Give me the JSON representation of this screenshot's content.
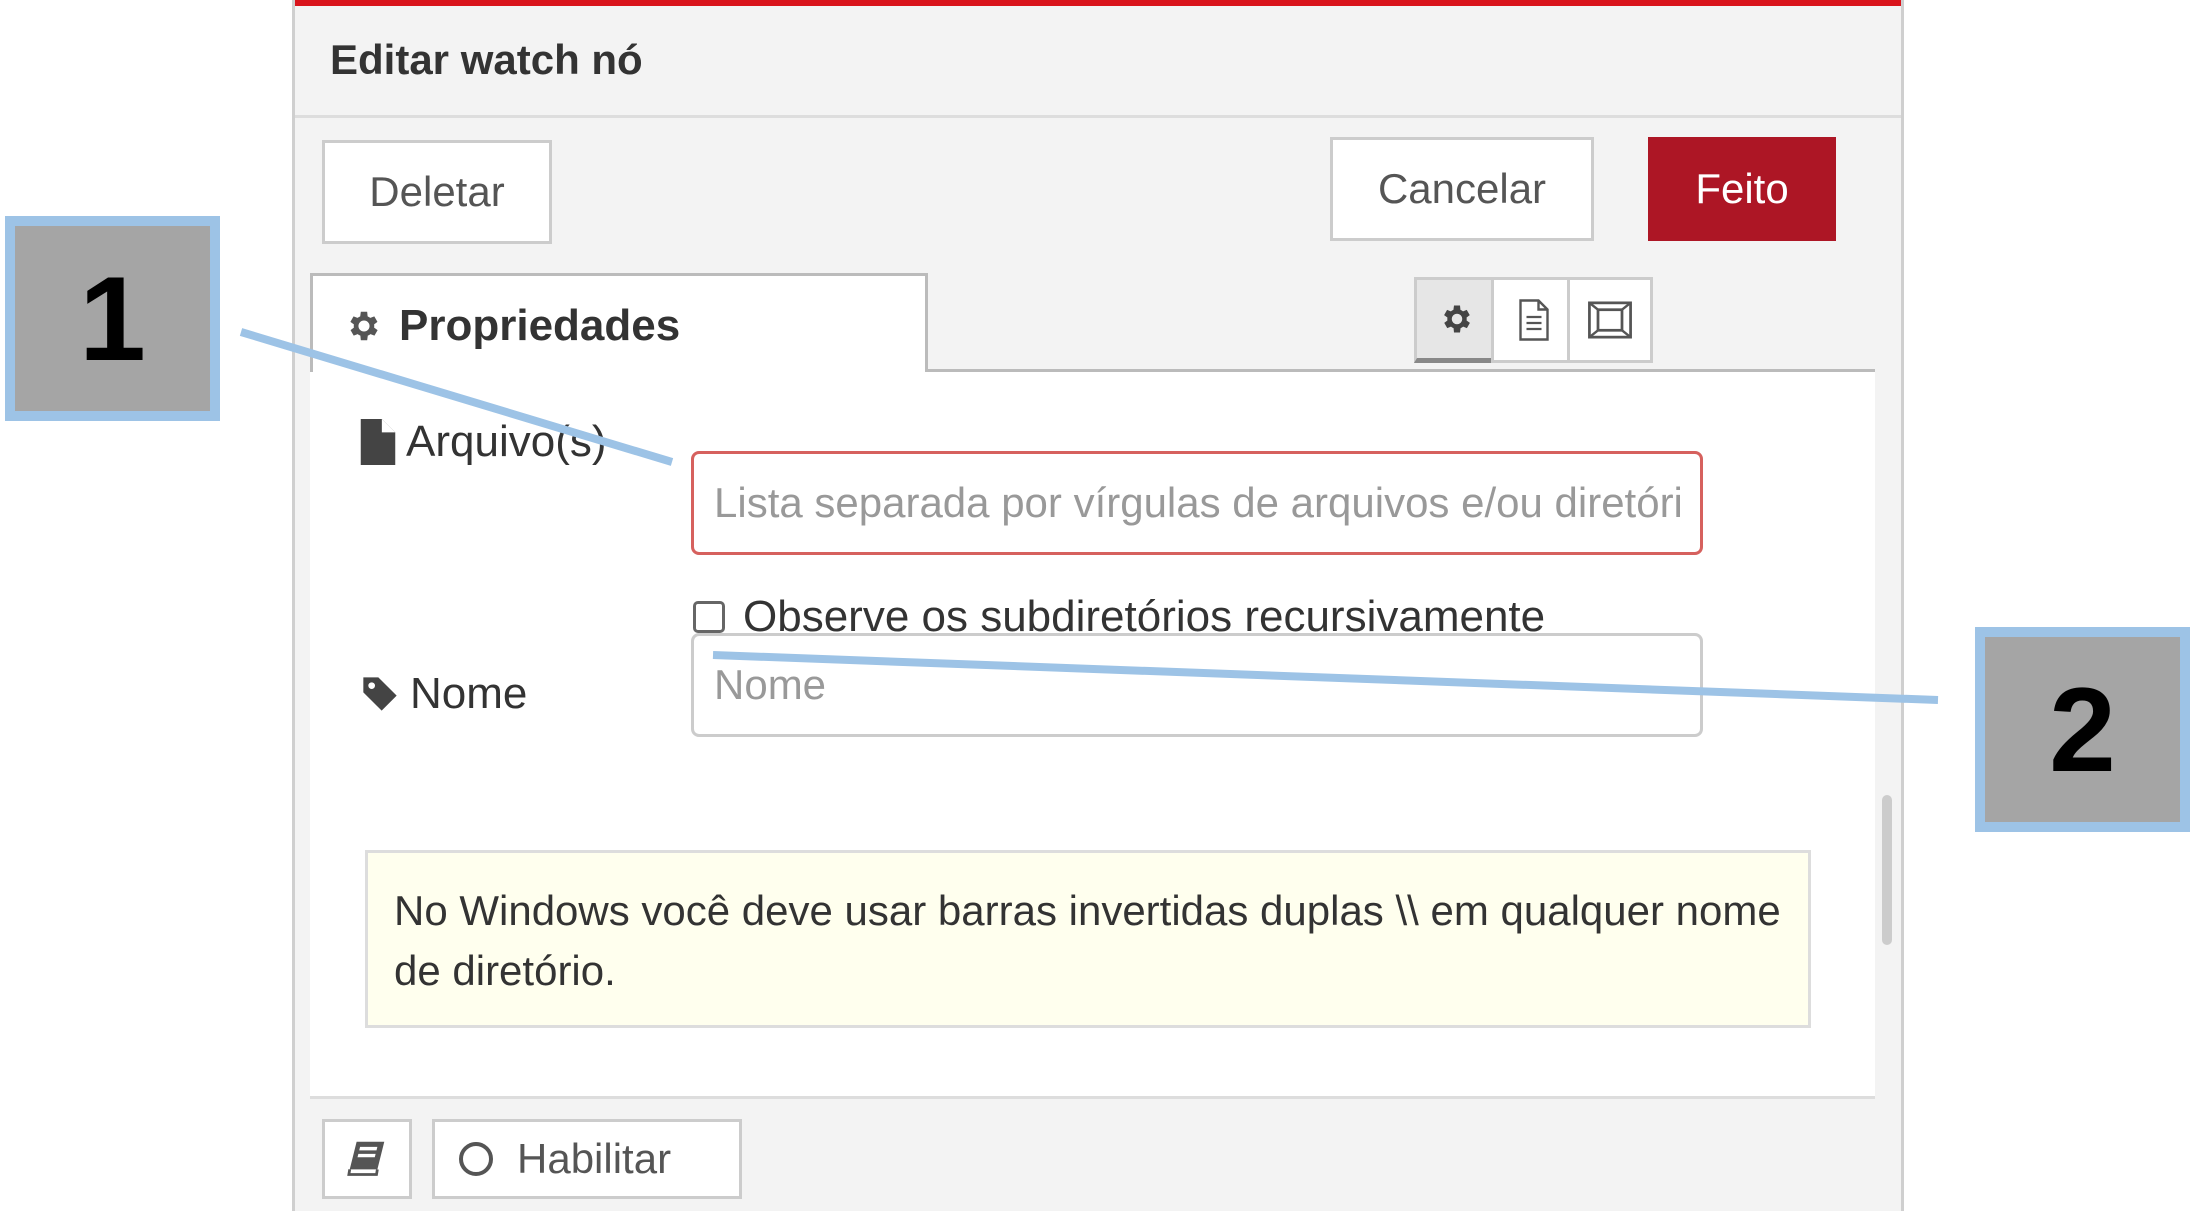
{
  "dialog": {
    "title": "Editar watch nó",
    "buttons": {
      "delete": "Deletar",
      "cancel": "Cancelar",
      "done": "Feito"
    },
    "tabs": {
      "properties": "Propriedades"
    },
    "tab_icons": [
      "gear-icon",
      "description-icon",
      "appearance-icon"
    ],
    "fields": {
      "files": {
        "label": "Arquivo(s)",
        "value": "",
        "placeholder": "Lista separada por vírgulas de arquivos e/ou diretórios"
      },
      "recursive": {
        "label": "Observe os subdiretórios recursivamente",
        "checked": false
      },
      "name": {
        "label": "Nome",
        "value": "",
        "placeholder": "Nome"
      }
    },
    "tip": "No Windows você deve usar barras invertidas duplas \\\\ em qualquer nome de diretório.",
    "footer": {
      "enable": "Habilitar"
    },
    "colors": {
      "accent": "#ad1625",
      "top_bar": "#d9141c",
      "invalid_border": "#d6615e",
      "tip_bg": "#ffffee"
    }
  },
  "annotations": {
    "callout_1": "1",
    "callout_2": "2",
    "color": "#9dc3e6"
  }
}
